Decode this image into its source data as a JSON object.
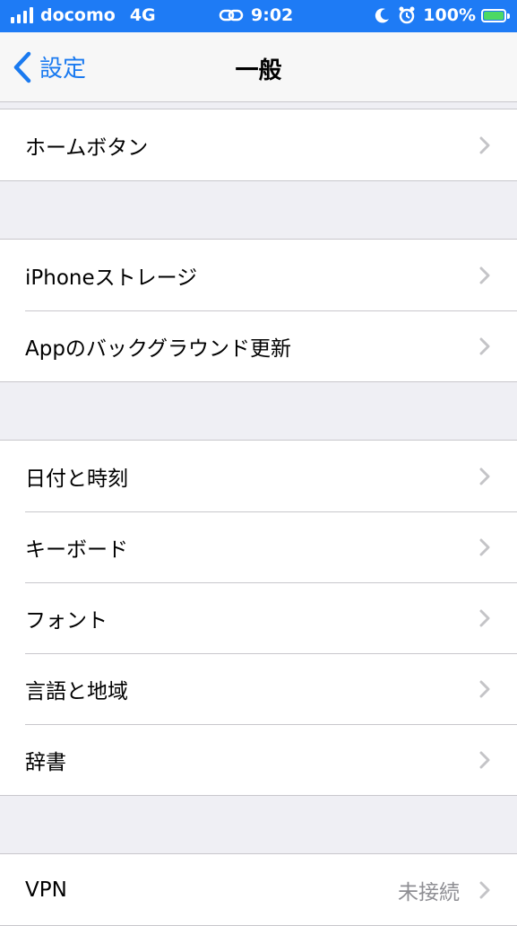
{
  "status_bar": {
    "carrier": "docomo",
    "network": "4G",
    "time": "9:02",
    "battery": "100%"
  },
  "nav": {
    "back_label": "設定",
    "title": "一般"
  },
  "groups": [
    {
      "items": [
        {
          "label": "ホームボタン"
        }
      ]
    },
    {
      "items": [
        {
          "label": "iPhoneストレージ"
        },
        {
          "label": "Appのバックグラウンド更新"
        }
      ]
    },
    {
      "items": [
        {
          "label": "日付と時刻"
        },
        {
          "label": "キーボード"
        },
        {
          "label": "フォント"
        },
        {
          "label": "言語と地域"
        },
        {
          "label": "辞書"
        }
      ]
    },
    {
      "items": [
        {
          "label": "VPN",
          "value": "未接続"
        }
      ]
    }
  ],
  "colors": {
    "status_bar_bg": "#1e7bf5",
    "accent": "#1a7af0",
    "battery_fill": "#4cd964",
    "background": "#efeff4"
  }
}
